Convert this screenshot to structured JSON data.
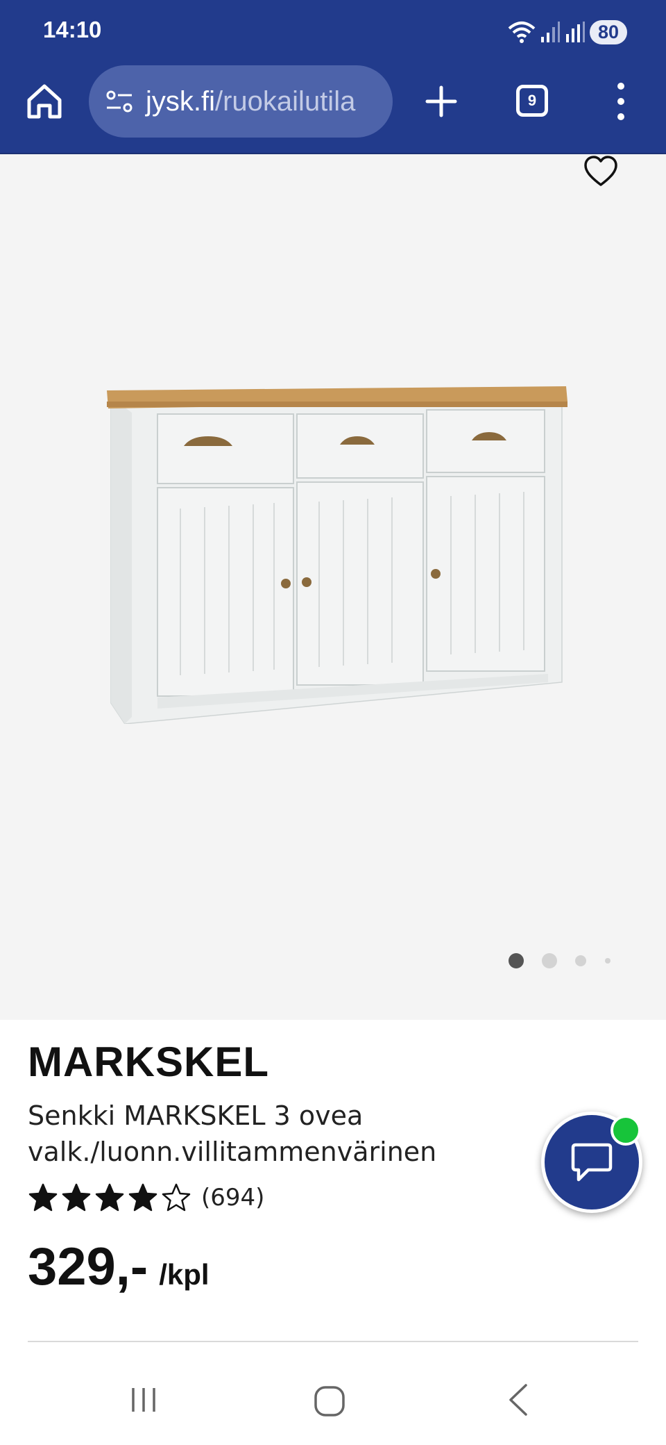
{
  "status_bar": {
    "time": "14:10",
    "battery": "80",
    "icons": [
      "wifi-icon",
      "signal-icon",
      "signal-icon"
    ]
  },
  "browser": {
    "url_domain": "jysk.fi",
    "url_path": "/ruokailutila",
    "tab_count": "9",
    "icons": [
      "home-icon",
      "site-settings-icon",
      "plus-icon",
      "tabs-icon",
      "more-vert-icon"
    ]
  },
  "gallery": {
    "image_count": 4,
    "active_index": 0,
    "colors": {
      "active_dot": "#555555",
      "inactive_dot": "#d3d3d3"
    }
  },
  "product": {
    "brand": "MARKSKEL",
    "description": "Senkki MARKSKEL 3 ovea valk./luonn.villitammenvärinen",
    "rating_stars": 4,
    "rating_max": 5,
    "review_count": "(694)",
    "price": "329,-",
    "unit": "/kpl"
  },
  "colors": {
    "brand_blue": "#223b8c",
    "online_green": "#17c43a",
    "image_bg": "#f4f4f4"
  }
}
